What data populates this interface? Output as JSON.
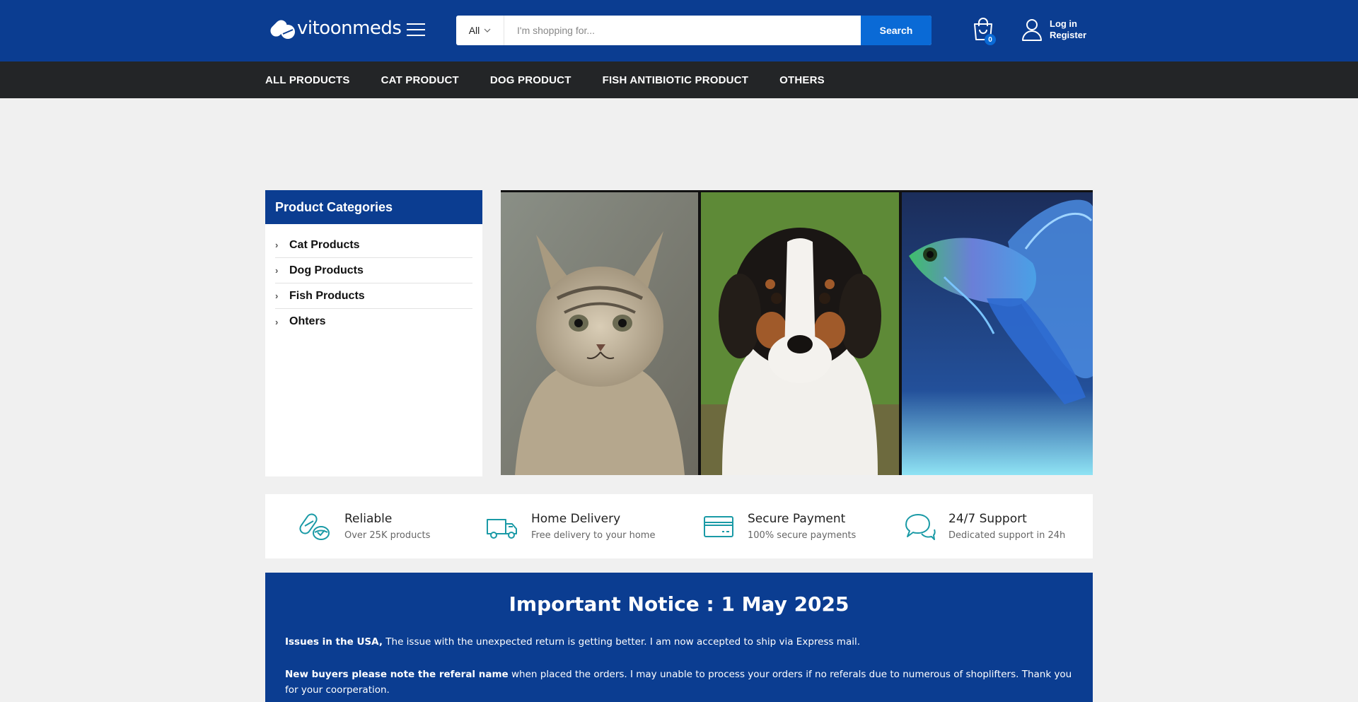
{
  "header": {
    "logo_text": "vitoonmeds",
    "search": {
      "category": "All",
      "placeholder": "I'm shopping for...",
      "button_label": "Search"
    },
    "cart_count": "0",
    "login_label": "Log in",
    "register_label": "Register"
  },
  "nav": {
    "items": [
      "ALL PRODUCTS",
      "CAT PRODUCT",
      "DOG PRODUCT",
      "FISH ANTIBIOTIC PRODUCT",
      "OTHERS"
    ]
  },
  "sidebar": {
    "title": "Product Categories",
    "items": [
      "Cat Products",
      "Dog Products",
      "Fish Products",
      "Ohters"
    ]
  },
  "banner": {
    "panels": [
      "kitten",
      "puppy",
      "guppy-fish"
    ]
  },
  "features": [
    {
      "icon": "pills-icon",
      "title": "Reliable",
      "subtitle": "Over 25K products"
    },
    {
      "icon": "truck-icon",
      "title": "Home Delivery",
      "subtitle": "Free delivery to your home"
    },
    {
      "icon": "credit-card-icon",
      "title": "Secure Payment",
      "subtitle": "100% secure payments"
    },
    {
      "icon": "chat-icon",
      "title": "24/7 Support",
      "subtitle": "Dedicated support in 24h"
    }
  ],
  "notice": {
    "title": "Important Notice : 1 May 2025",
    "p1_bold": "Issues in the USA,",
    "p1_text": " The issue with the unexpected return is getting better. I am now accepted to ship via Express mail.",
    "p2_bold": "New buyers please note the referal name",
    "p2_text": " when placed the orders. I may unable to process your orders if no referals due to numerous of shoplifters. Thank you for your coorperation."
  },
  "colors": {
    "brand_blue": "#0b3d91",
    "accent_blue": "#0a6ad6",
    "nav_dark": "#232527",
    "icon_teal": "#1a9aa6"
  }
}
